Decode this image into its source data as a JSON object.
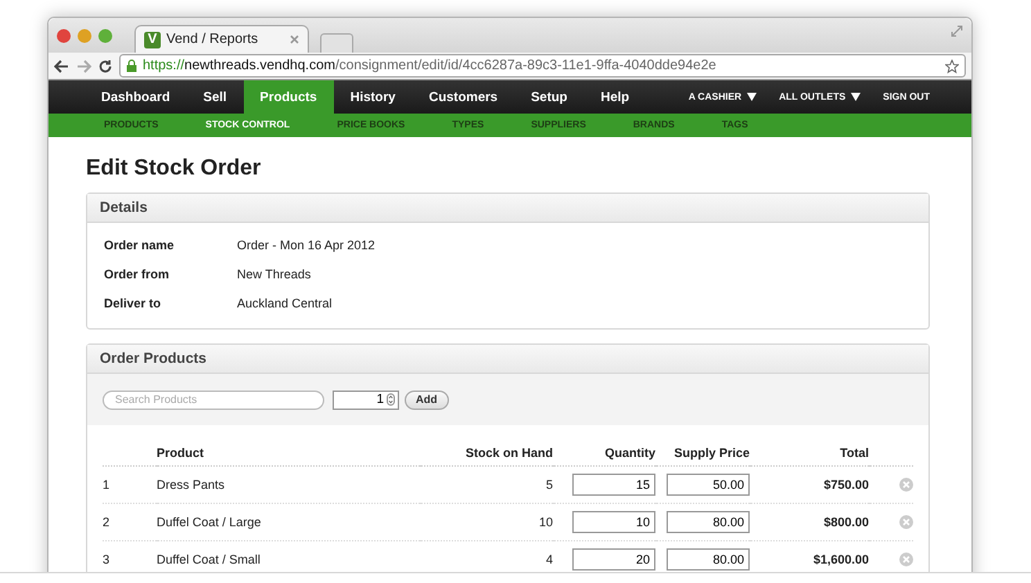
{
  "browser": {
    "tab": {
      "logo_letter": "V",
      "title": "Vend / Reports"
    },
    "url": {
      "scheme": "https://",
      "host": "newthreads.vendhq.com",
      "path": "/consignment/edit/id/4cc6287a-89c3-11e1-9ffa-4040dde94e2e"
    }
  },
  "nav": {
    "items": [
      {
        "label": "Dashboard",
        "selected": false
      },
      {
        "label": "Sell",
        "selected": false
      },
      {
        "label": "Products",
        "selected": true
      },
      {
        "label": "History",
        "selected": false
      },
      {
        "label": "Customers",
        "selected": false
      },
      {
        "label": "Setup",
        "selected": false
      },
      {
        "label": "Help",
        "selected": false
      }
    ],
    "menus": [
      {
        "label": "A CASHIER"
      },
      {
        "label": "ALL OUTLETS"
      }
    ],
    "sign_out": "SIGN OUT"
  },
  "subnav": [
    {
      "label": "PRODUCTS",
      "selected": false
    },
    {
      "label": "STOCK CONTROL",
      "selected": true
    },
    {
      "label": "PRICE BOOKS",
      "selected": false
    },
    {
      "label": "TYPES",
      "selected": false
    },
    {
      "label": "SUPPLIERS",
      "selected": false
    },
    {
      "label": "BRANDS",
      "selected": false
    },
    {
      "label": "TAGS",
      "selected": false
    }
  ],
  "page_title": "Edit Stock Order",
  "details": {
    "title": "Details",
    "fields": [
      {
        "label": "Order name",
        "value": "Order - Mon 16 Apr 2012"
      },
      {
        "label": "Order from",
        "value": "New Threads"
      },
      {
        "label": "Deliver to",
        "value": "Auckland Central"
      }
    ]
  },
  "order_products": {
    "title": "Order Products",
    "search": {
      "placeholder": "Search Products"
    },
    "quantity": "1",
    "add_button": "Add",
    "columns": [
      "",
      "Product",
      "Stock on Hand",
      "Quantity",
      "Supply Price",
      "Total"
    ],
    "rows": [
      {
        "number": "1",
        "product": "Dress Pants",
        "stock": "5",
        "quantity": "15",
        "supply_price": "50.00",
        "total": "$750.00"
      },
      {
        "number": "2",
        "product": "Duffel Coat / Large",
        "stock": "10",
        "quantity": "10",
        "supply_price": "80.00",
        "total": "$800.00"
      },
      {
        "number": "3",
        "product": "Duffel Coat / Small",
        "stock": "4",
        "quantity": "20",
        "supply_price": "80.00",
        "total": "$1,600.00"
      }
    ]
  }
}
